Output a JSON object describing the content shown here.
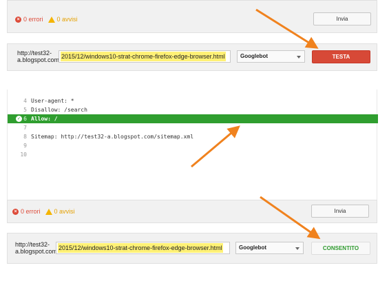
{
  "top": {
    "errors": "0 errori",
    "warnings": "0 avvisi",
    "submit_label": "Invia",
    "url_prefix": "http://test32-a.blogspot.com/",
    "url_prefix_line1": "http://test32-",
    "url_prefix_line2": "a.blogspot.com/",
    "url_value": "2015/12/windows10-strat-chrome-firefox-edge-browser.html",
    "agent_select": "Googlebot",
    "test_button": "TESTA"
  },
  "editor": {
    "lines": [
      {
        "num": "4",
        "text": "User-agent: *"
      },
      {
        "num": "5",
        "text": "Disallow: /search"
      },
      {
        "num": "6",
        "text": "Allow: /",
        "highlight": true
      },
      {
        "num": "7",
        "text": ""
      },
      {
        "num": "8",
        "text": "Sitemap: http://test32-a.blogspot.com/sitemap.xml"
      },
      {
        "num": "9",
        "text": ""
      },
      {
        "num": "10",
        "text": ""
      }
    ]
  },
  "bottom": {
    "errors": "0 errori",
    "warnings": "0 avvisi",
    "submit_label": "Invia",
    "url_prefix_line1": "http://test32-",
    "url_prefix_line2": "a.blogspot.com/",
    "url_value": "2015/12/windows10-strat-chrome-firefox-edge-browser.html",
    "agent_select": "Googlebot",
    "result_label": "CONSENTITO"
  },
  "colors": {
    "arrow": "#f0821e",
    "allow_line": "#2f9e2f",
    "test_button": "#d74937",
    "highlight": "#fff176",
    "error": "#dd4b39",
    "warning": "#f4b400",
    "consentito": "#2e9a2e"
  },
  "icons": [
    "error-icon",
    "warning-icon",
    "check-icon",
    "arrow-icon",
    "chevron-down-icon"
  ]
}
